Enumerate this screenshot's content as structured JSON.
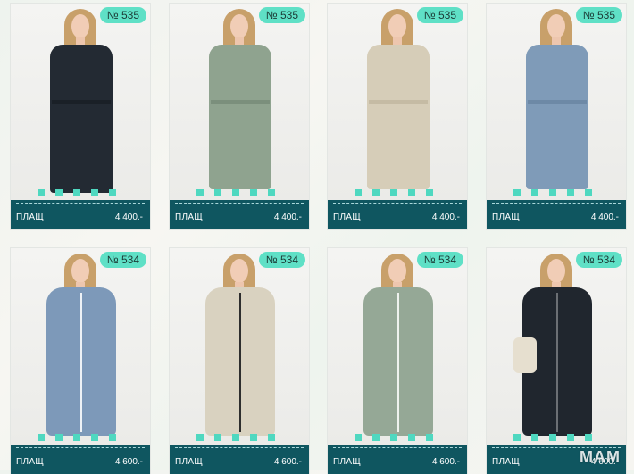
{
  "products": [
    {
      "badge": "№ 535",
      "name": "ПЛАЩ",
      "price": "4 400.-",
      "coat_color": "#232a33",
      "style": "trench"
    },
    {
      "badge": "№ 535",
      "name": "ПЛАЩ",
      "price": "4 400.-",
      "coat_color": "#8fa38f",
      "style": "trench"
    },
    {
      "badge": "№ 535",
      "name": "ПЛАЩ",
      "price": "4 400.-",
      "coat_color": "#d6cdb8",
      "style": "trench"
    },
    {
      "badge": "№ 535",
      "name": "ПЛАЩ",
      "price": "4 400.-",
      "coat_color": "#7f9bb8",
      "style": "trench"
    },
    {
      "badge": "№ 534",
      "name": "ПЛАЩ",
      "price": "4 600.-",
      "coat_color": "#7d99b9",
      "style": "parka"
    },
    {
      "badge": "№ 534",
      "name": "ПЛАЩ",
      "price": "4 600.-",
      "coat_color": "#d9d2c0",
      "style": "parka"
    },
    {
      "badge": "№ 534",
      "name": "ПЛАЩ",
      "price": "4 600.-",
      "coat_color": "#95a896",
      "style": "parka"
    },
    {
      "badge": "№ 534",
      "name": "ПЛАЩ",
      "price": "4 600.-",
      "coat_color": "#20262e",
      "style": "parka"
    }
  ],
  "watermark": "МАМ"
}
